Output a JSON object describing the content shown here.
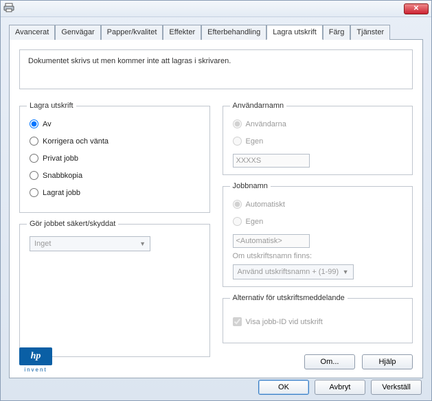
{
  "titlebar": {
    "title": ""
  },
  "tabs": {
    "items": [
      {
        "label": "Avancerat"
      },
      {
        "label": "Genvägar"
      },
      {
        "label": "Papper/kvalitet"
      },
      {
        "label": "Effekter"
      },
      {
        "label": "Efterbehandling"
      },
      {
        "label": "Lagra utskrift"
      },
      {
        "label": "Färg"
      },
      {
        "label": "Tjänster"
      }
    ],
    "active": "Lagra utskrift"
  },
  "message": "Dokumentet skrivs ut men kommer inte att lagras i skrivaren.",
  "left": {
    "storage": {
      "legend": "Lagra utskrift",
      "options": [
        {
          "label": "Av",
          "checked": true
        },
        {
          "label": "Korrigera och vänta",
          "checked": false
        },
        {
          "label": "Privat jobb",
          "checked": false
        },
        {
          "label": "Snabbkopia",
          "checked": false
        },
        {
          "label": "Lagrat jobb",
          "checked": false
        }
      ]
    },
    "secure": {
      "legend": "Gör jobbet säkert/skyddat",
      "select_value": "Inget"
    }
  },
  "right": {
    "username": {
      "legend": "Användarnamn",
      "opt_auto": "Användarna",
      "opt_own": "Egen",
      "field_value": "XXXXS"
    },
    "jobname": {
      "legend": "Jobbnamn",
      "opt_auto": "Automatiskt",
      "opt_own": "Egen",
      "field_value": "<Automatisk>",
      "note": "Om utskriftsnamn finns:",
      "select_value": "Använd utskriftsnamn + (1-99)"
    },
    "alt": {
      "legend": "Alternativ för utskriftsmeddelande",
      "check_label": "Visa jobb-ID vid utskrift"
    }
  },
  "logo": {
    "brand": "hp",
    "sub": "invent"
  },
  "panel_buttons": {
    "about": "Om...",
    "help": "Hjälp"
  },
  "dialog_buttons": {
    "ok": "OK",
    "cancel": "Avbryt",
    "apply": "Verkställ"
  }
}
